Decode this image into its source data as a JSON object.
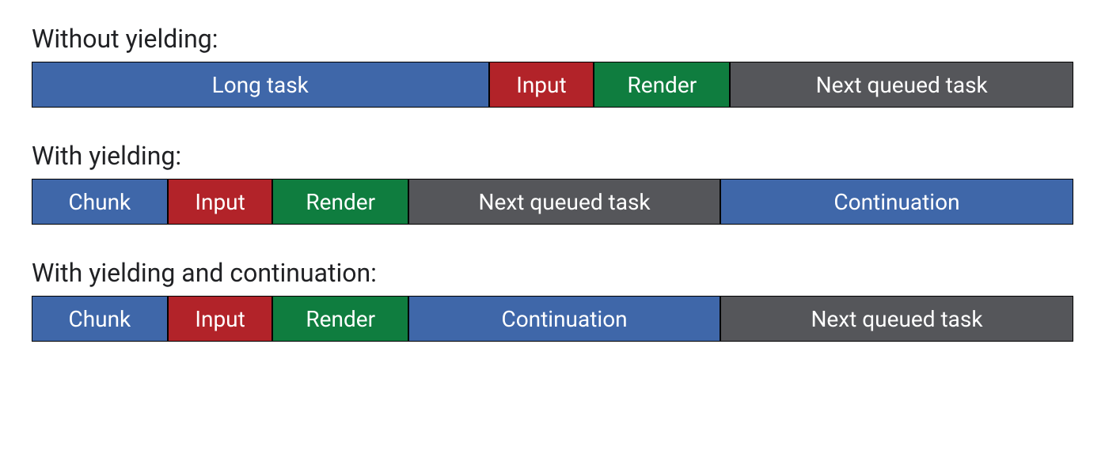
{
  "chart_data": {
    "type": "bar",
    "rows": [
      {
        "title": "Without yielding:",
        "segments": [
          {
            "label": "Long task",
            "color": "blue",
            "flex": 44
          },
          {
            "label": "Input",
            "color": "red",
            "flex": 10
          },
          {
            "label": "Render",
            "color": "green",
            "flex": 13
          },
          {
            "label": "Next queued task",
            "color": "gray",
            "flex": 33
          }
        ]
      },
      {
        "title": "With yielding:",
        "segments": [
          {
            "label": "Chunk",
            "color": "blue",
            "flex": 13
          },
          {
            "label": "Input",
            "color": "red",
            "flex": 10
          },
          {
            "label": "Render",
            "color": "green",
            "flex": 13
          },
          {
            "label": "Next queued task",
            "color": "gray",
            "flex": 30
          },
          {
            "label": "Continuation",
            "color": "blue",
            "flex": 34
          }
        ]
      },
      {
        "title": "With yielding and continuation:",
        "segments": [
          {
            "label": "Chunk",
            "color": "blue",
            "flex": 13
          },
          {
            "label": "Input",
            "color": "red",
            "flex": 10
          },
          {
            "label": "Render",
            "color": "green",
            "flex": 13
          },
          {
            "label": "Continuation",
            "color": "blue",
            "flex": 30
          },
          {
            "label": "Next queued task",
            "color": "gray",
            "flex": 34
          }
        ]
      }
    ]
  }
}
